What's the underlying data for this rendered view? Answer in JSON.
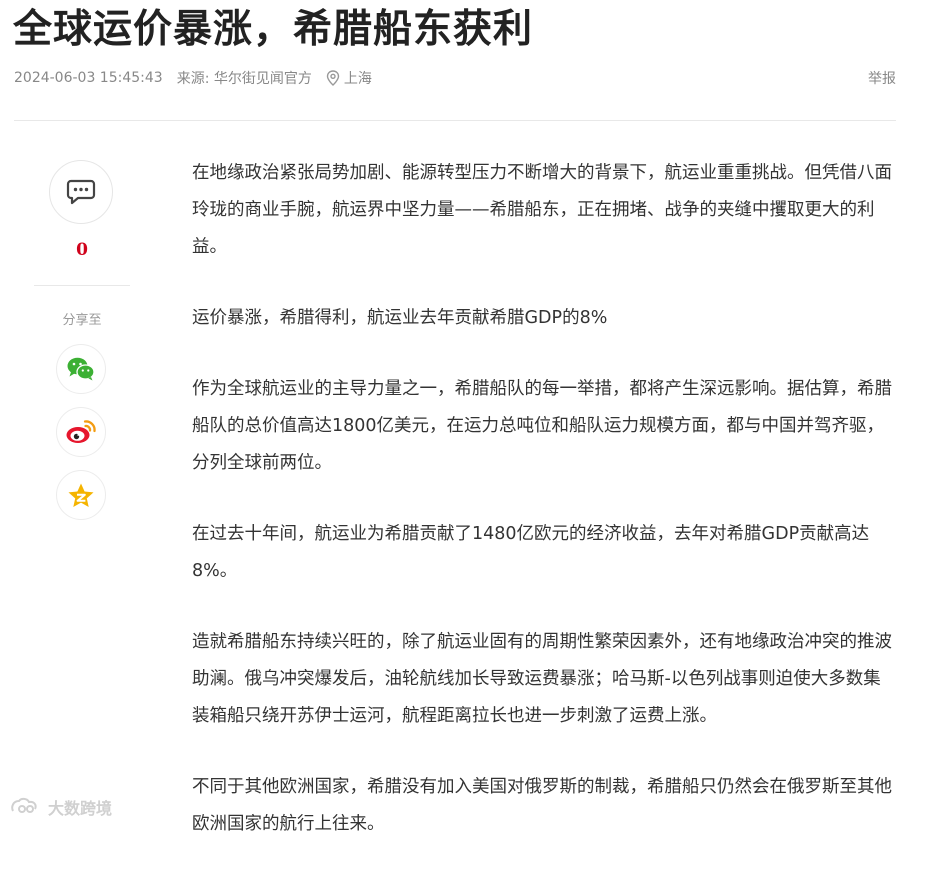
{
  "article": {
    "title": "全球运价暴涨，希腊船东获利",
    "date": "2024-06-03 15:45:43",
    "source": "来源: 华尔街见闻官方",
    "location": "上海",
    "report_label": "举报",
    "paragraphs": [
      "在地缘政治紧张局势加剧、能源转型压力不断增大的背景下，航运业重重挑战。但凭借八面玲珑的商业手腕，航运界中坚力量——希腊船东，正在拥堵、战争的夹缝中攫取更大的利益。",
      "运价暴涨，希腊得利，航运业去年贡献希腊GDP的8%",
      "作为全球航运业的主导力量之一，希腊船队的每一举措，都将产生深远影响。据估算，希腊船队的总价值高达1800亿美元，在运力总吨位和船队运力规模方面，都与中国并驾齐驱，分列全球前两位。",
      "在过去十年间，航运业为希腊贡献了1480亿欧元的经济收益，去年对希腊GDP贡献高达8%。",
      "造就希腊船东持续兴旺的，除了航运业固有的周期性繁荣因素外，还有地缘政治冲突的推波助澜。俄乌冲突爆发后，油轮航线加长导致运费暴涨；哈马斯-以色列战事则迫使大多数集装箱船只绕开苏伊士运河，航程距离拉长也进一步刺激了运费上涨。",
      "不同于其他欧洲国家，希腊没有加入美国对俄罗斯的制裁，希腊船只仍然会在俄罗斯至其他欧洲国家的航行上往来。"
    ]
  },
  "sidebar": {
    "comment_icon": "comment-icon",
    "comment_count": "0",
    "share_label": "分享至",
    "share_icons": [
      "wechat-icon",
      "weibo-icon",
      "qzone-icon"
    ]
  },
  "watermark": {
    "text": "大数跨境"
  },
  "colors": {
    "comment_count": "#d0021b",
    "wechat": "#3cb034",
    "weibo": "#e6162d",
    "qzone": "#f5b400",
    "title": "#222222",
    "meta": "#888888"
  }
}
